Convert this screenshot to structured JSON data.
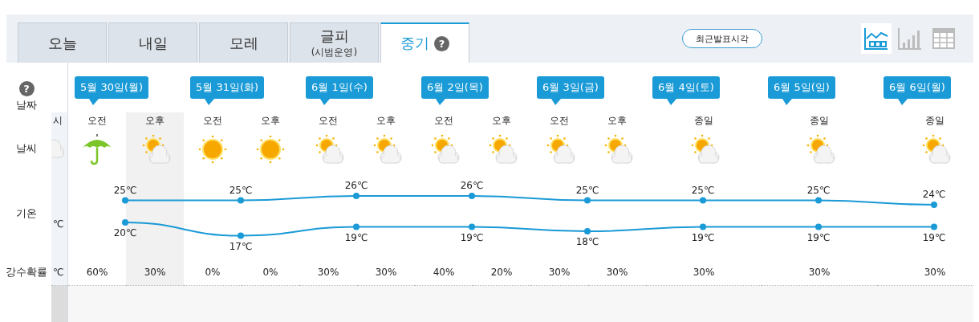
{
  "tabs": [
    {
      "label": "오늘",
      "selected": false
    },
    {
      "label": "내일",
      "selected": false
    },
    {
      "label": "모레",
      "selected": false
    },
    {
      "label": "글피",
      "sublabel": "(시범운영)",
      "selected": false
    },
    {
      "label": "중기",
      "help": "?",
      "selected": true
    }
  ],
  "latest_button": "최근발표시각",
  "view_buttons": [
    {
      "kind": "graph",
      "selected": true
    },
    {
      "kind": "bars",
      "selected": false
    },
    {
      "kind": "table",
      "selected": false
    }
  ],
  "row_labels": {
    "help": "?",
    "date": "날짜",
    "weather": "날씨",
    "temperature": "기온",
    "precipitation": "강수확률"
  },
  "previous_column": {
    "period": "시",
    "icon": {
      "kind": "cloudy"
    },
    "temperature": "℃",
    "precipitation": "℃"
  },
  "days": [
    {
      "date": "5월 30일(월)",
      "slots": [
        {
          "period": "오전",
          "icon": {
            "kind": "rain"
          },
          "precipitation": "60%",
          "highlighted": false
        },
        {
          "period": "오후",
          "icon": {
            "kind": "partly-cloudy"
          },
          "precipitation": "30%",
          "highlighted": true
        }
      ]
    },
    {
      "date": "5월 31일(화)",
      "slots": [
        {
          "period": "오전",
          "icon": {
            "kind": "sunny"
          },
          "precipitation": "0%",
          "highlighted": false
        },
        {
          "period": "오후",
          "icon": {
            "kind": "sunny"
          },
          "precipitation": "0%",
          "highlighted": false
        }
      ]
    },
    {
      "date": "6월 1일(수)",
      "slots": [
        {
          "period": "오전",
          "icon": {
            "kind": "partly-cloudy"
          },
          "precipitation": "30%",
          "highlighted": false
        },
        {
          "period": "오후",
          "icon": {
            "kind": "partly-cloudy"
          },
          "precipitation": "30%",
          "highlighted": false
        }
      ]
    },
    {
      "date": "6월 2일(목)",
      "slots": [
        {
          "period": "오전",
          "icon": {
            "kind": "partly-cloudy"
          },
          "precipitation": "40%",
          "highlighted": false
        },
        {
          "period": "오후",
          "icon": {
            "kind": "partly-cloudy"
          },
          "precipitation": "20%",
          "highlighted": false
        }
      ]
    },
    {
      "date": "6월 3일(금)",
      "slots": [
        {
          "period": "오전",
          "icon": {
            "kind": "partly-cloudy"
          },
          "precipitation": "30%",
          "highlighted": false
        },
        {
          "period": "오후",
          "icon": {
            "kind": "partly-cloudy"
          },
          "precipitation": "30%",
          "highlighted": false
        }
      ]
    },
    {
      "date": "6월 4일(토)",
      "slots": [
        {
          "period": "종일",
          "icon": {
            "kind": "partly-cloudy"
          },
          "precipitation": "30%",
          "highlighted": false
        }
      ]
    },
    {
      "date": "6월 5일(일)",
      "slots": [
        {
          "period": "종일",
          "icon": {
            "kind": "partly-cloudy"
          },
          "precipitation": "30%",
          "highlighted": false
        }
      ]
    },
    {
      "date": "6월 6일(월)",
      "slots": [
        {
          "period": "종일",
          "icon": {
            "kind": "partly-cloudy"
          },
          "precipitation": "30%",
          "highlighted": false
        }
      ]
    }
  ],
  "chart_data": {
    "type": "line",
    "data_labels": true,
    "series": [
      {
        "color": "#1a9ad6",
        "marker": "circle",
        "values": [
          25,
          25,
          26,
          26,
          25,
          25,
          25,
          24
        ],
        "value_labels": [
          "25℃",
          "25℃",
          "26℃",
          "26℃",
          "25℃",
          "25℃",
          "25℃",
          "24℃"
        ]
      },
      {
        "color": "#1a9ad6",
        "marker": "circle",
        "values": [
          20,
          17,
          19,
          19,
          18,
          19,
          19,
          19
        ],
        "value_labels": [
          "20℃",
          "17℃",
          "19℃",
          "19℃",
          "18℃",
          "19℃",
          "19℃",
          "19℃"
        ]
      }
    ]
  }
}
